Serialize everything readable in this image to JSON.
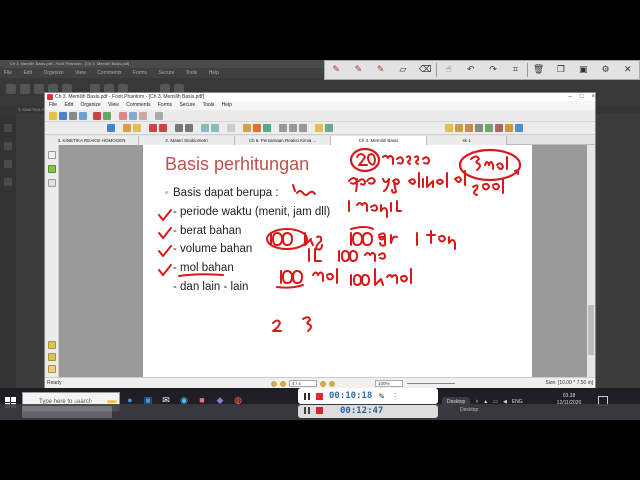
{
  "background_window": {
    "title": "Ch 3. Memilih Basis.pdf - Foxit Phantom - [Ch 3. Memilih Basis.pdf]",
    "menu": [
      "File",
      "Edit",
      "Organize",
      "View",
      "Comments",
      "Forms",
      "Secure",
      "Tools",
      "Help"
    ],
    "tabs": [
      "3. KINETIKA REAKSI HOMOGEN"
    ],
    "status": "Ready"
  },
  "window": {
    "title": "Ch 3. Memilih Basis.pdf - Foxit Phantom - [Ch 3. Memilih Basis.pdf]",
    "controls": [
      "–",
      "□",
      "×"
    ],
    "menu": [
      "File",
      "Edit",
      "Organize",
      "View",
      "Comments",
      "Forms",
      "Secure",
      "Tools",
      "Help"
    ],
    "find_placeholder": "Find",
    "tabs": [
      "3. KINETIKA REAKSI HOMOGEN",
      "2. Materi Stoikiometri",
      "Ch 6. Persamaan Reaksi Kimia ...",
      "Ch 3. Memilih Basis",
      "sk 1"
    ],
    "active_tab_index": 3,
    "status": {
      "ready": "Ready",
      "page": "4 / 4",
      "zoom": "100%",
      "size": "Size: [10.00 * 7.50 in]"
    }
  },
  "slide": {
    "title": "Basis perhitungan",
    "lines": [
      "Basis dapat berupa :",
      "- periode waktu (menit, jam dll)",
      "- berat bahan",
      "- volume bahan",
      "- mol bahan",
      "- dan lain - lain"
    ],
    "ink_color": "#d61a1a"
  },
  "recorder": {
    "time": "00:10:18",
    "ghost_time": "00:12:47"
  },
  "taskbar": {
    "search_placeholder": "Type here to search",
    "desktop_label": "Desktop",
    "language": "ENG",
    "time": "03.38",
    "date": "12/11/2020"
  },
  "icons": {
    "annotation_tools": [
      "pen-icon",
      "pen-icon",
      "pen-icon",
      "highlighter-icon",
      "eraser-icon",
      "lasso-icon",
      "undo-icon",
      "redo-icon",
      "crop-icon",
      "trash-icon",
      "copy-icon",
      "paste-icon",
      "gear-icon",
      "close-icon"
    ]
  }
}
